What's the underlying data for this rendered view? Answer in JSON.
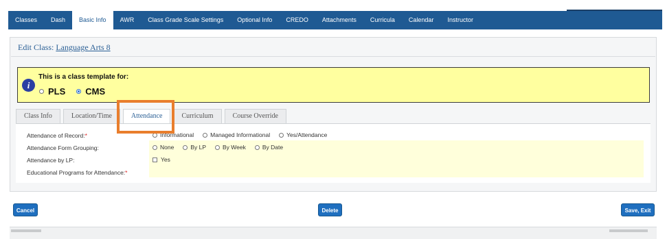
{
  "topnav": {
    "tabs": [
      "Classes",
      "Dash",
      "Basic Info",
      "AWR",
      "Class Grade Scale Settings",
      "Optional Info",
      "CREDO",
      "Attachments",
      "Curricula",
      "Calendar",
      "Instructor"
    ],
    "active": "Basic Info"
  },
  "edit": {
    "prefix": "Edit Class:",
    "class_name": "Language Arts 8"
  },
  "notice": {
    "text": "This is a class template for:",
    "options": [
      {
        "label": "PLS",
        "checked": false
      },
      {
        "label": "CMS",
        "checked": true
      }
    ]
  },
  "subtabs": {
    "items": [
      "Class Info",
      "Location/Time",
      "Attendance",
      "Curriculum",
      "Course Override"
    ],
    "active": "Attendance"
  },
  "form": {
    "attendance_of_record": {
      "label": "Attendance of Record:",
      "required": "*",
      "options": [
        "Informational",
        "Managed Informational",
        "Yes/Attendance"
      ]
    },
    "form_grouping": {
      "label": "Attendance Form Grouping:",
      "options": [
        "None",
        "By LP",
        "By Week",
        "By Date"
      ]
    },
    "by_lp": {
      "label": "Attendance by LP:",
      "checkbox_label": "Yes"
    },
    "programs": {
      "label": "Educational Programs for Attendance:",
      "required": "*"
    }
  },
  "buttons": {
    "cancel": "Cancel",
    "delete": "Delete",
    "save_exit": "Save, Exit"
  },
  "colors": {
    "nav": "#1f5a93",
    "notice_bg": "#ffff9f",
    "highlight": "#e97e2d",
    "button": "#1f6fbf"
  }
}
